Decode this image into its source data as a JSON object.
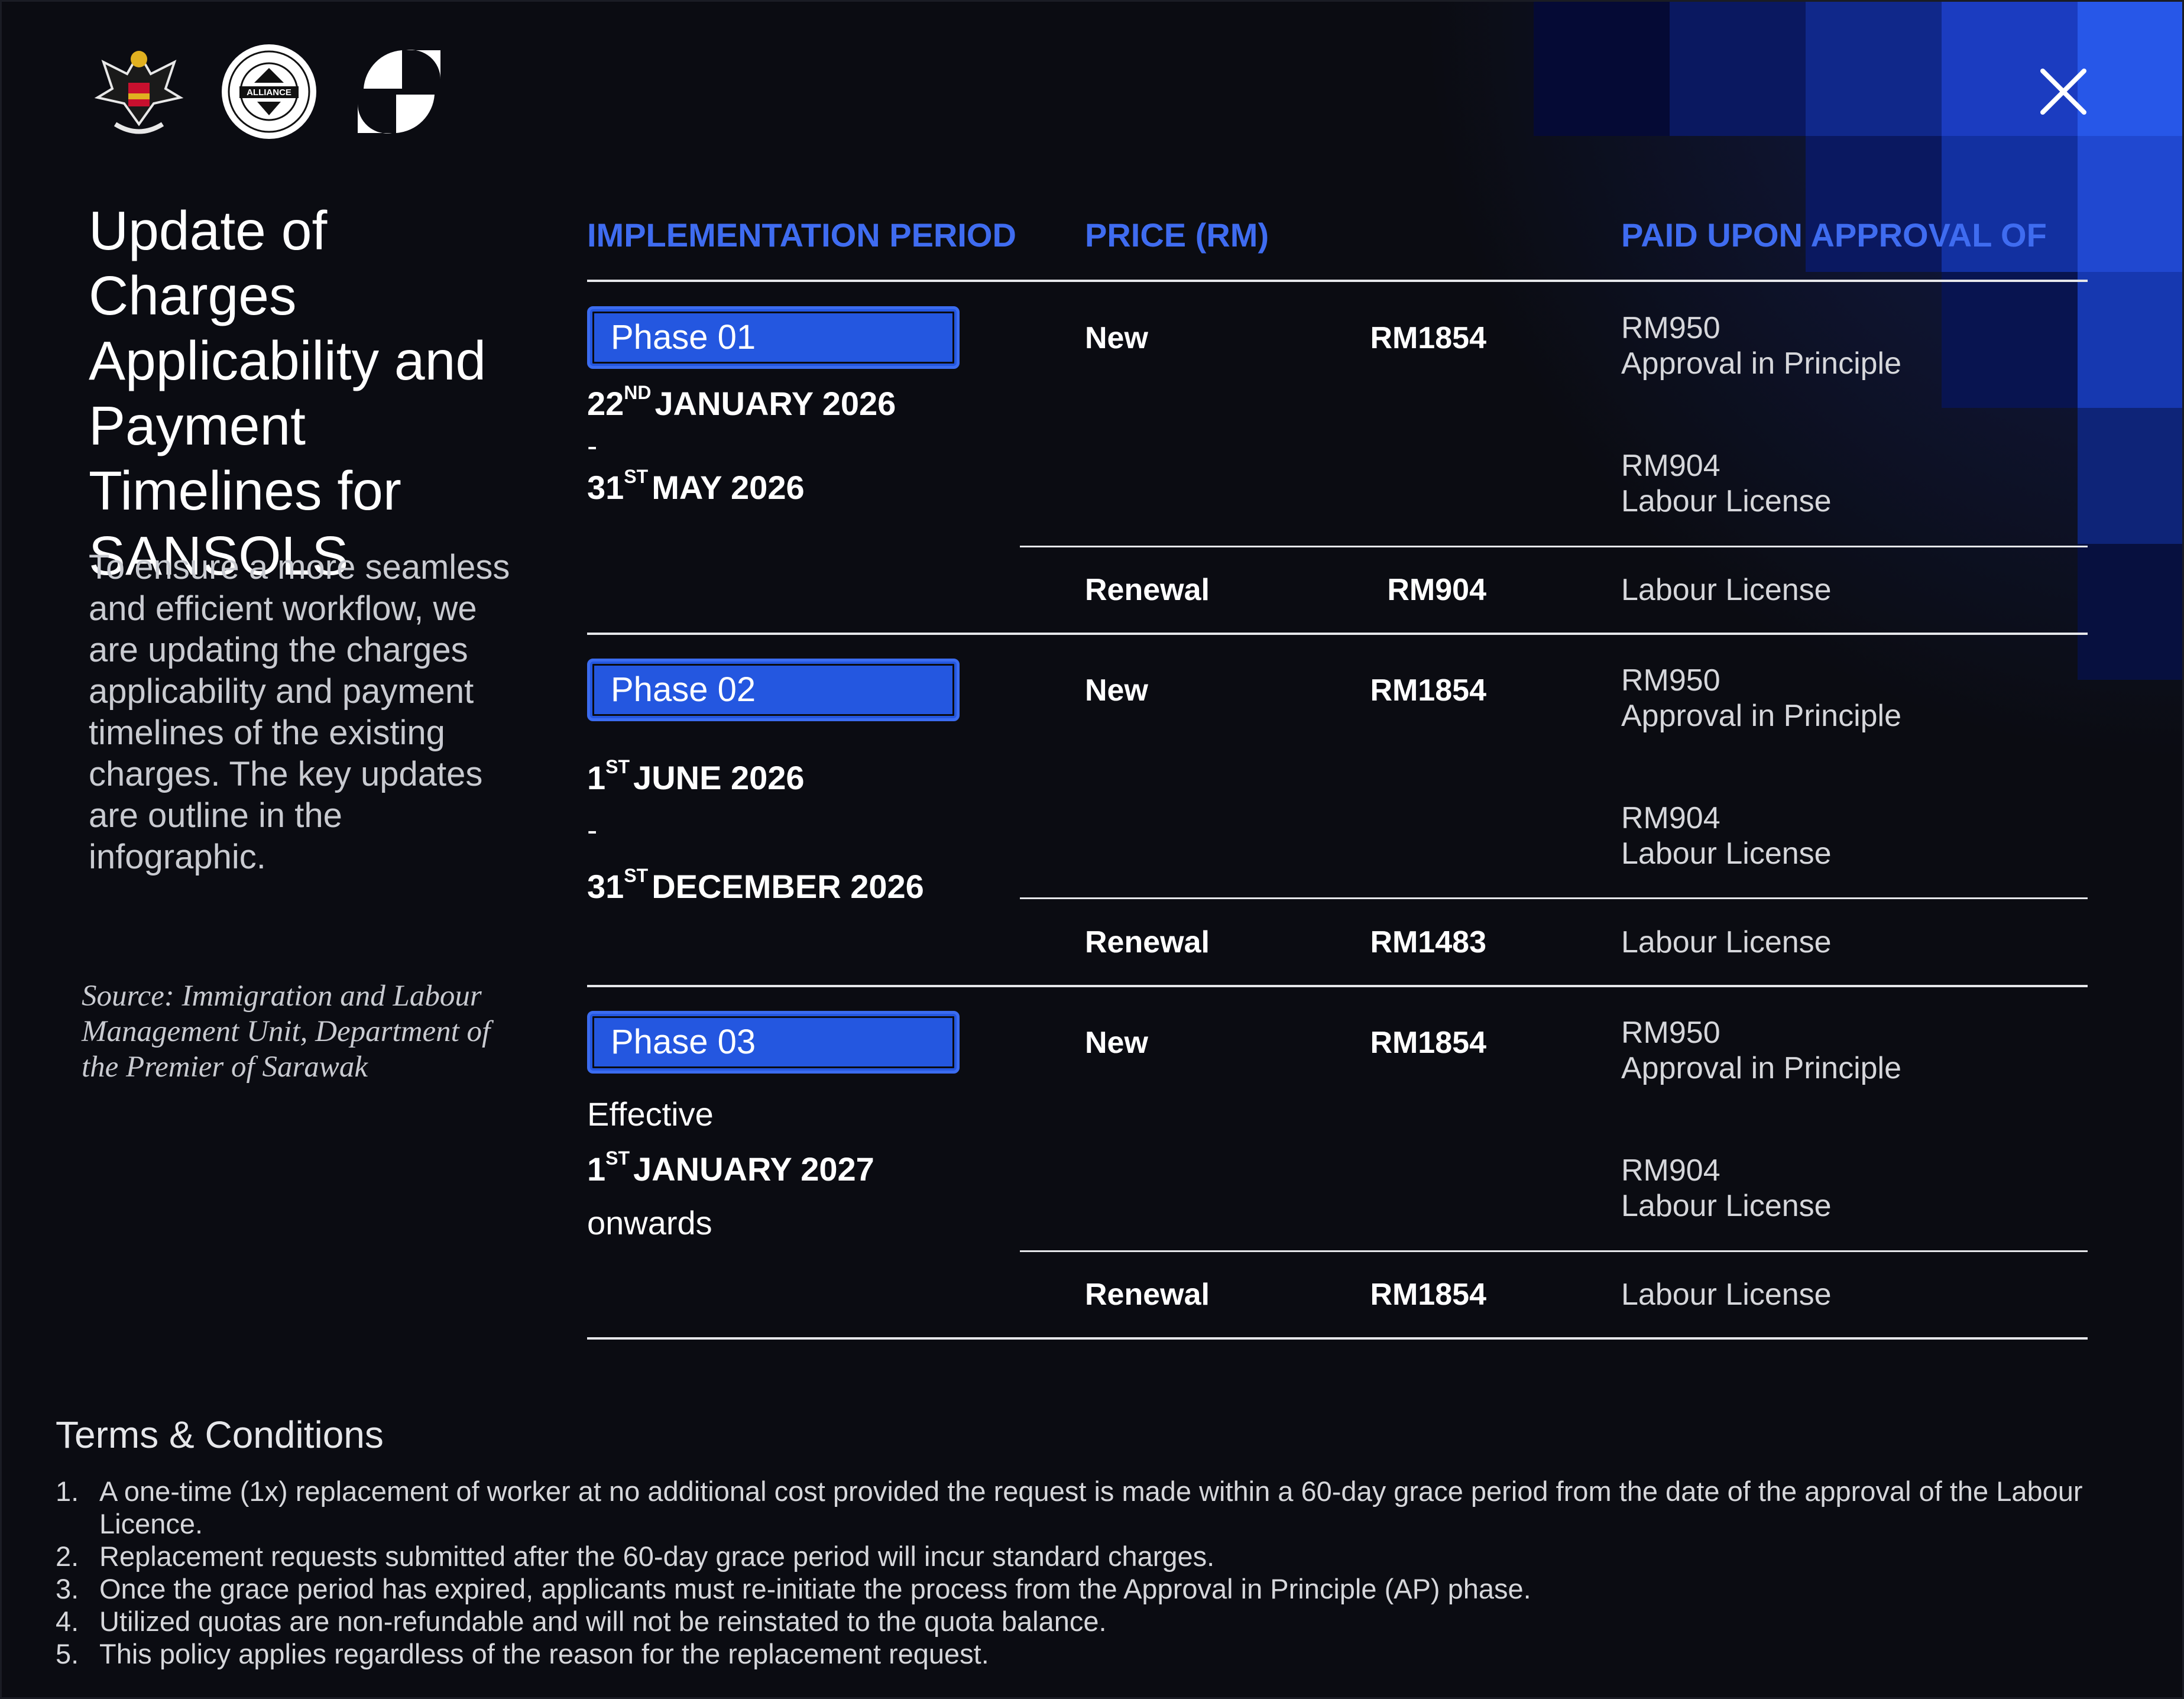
{
  "header": {
    "logos": [
      {
        "name": "sarawak-coat-of-arms-logo"
      },
      {
        "name": "alliance-seal-logo",
        "text": "ALLIANCE"
      },
      {
        "name": "sansols-s-logo"
      }
    ],
    "close_icon": "close-icon"
  },
  "sidebar": {
    "title": "Update of Charges Applicability and Payment Timelines for SANSOLS",
    "intro": "To ensure a more seamless and efficient workflow, we are updating the charges applicability and payment timelines of the existing charges. The key updates are outline in the infographic.",
    "source": "Source: Immigration and Labour Management Unit, Department of the Premier of Sarawak"
  },
  "table": {
    "headers": {
      "period": "IMPLEMENTATION PERIOD",
      "price": "PRICE (RM)",
      "paid": "PAID UPON APPROVAL OF"
    },
    "phases": [
      {
        "badge": "Phase 01",
        "start_day": "22",
        "start_suffix": "ND",
        "start_rest": "JANUARY 2026",
        "separator": "-",
        "end_day": "31",
        "end_suffix": "ST",
        "end_rest": "MAY 2026",
        "new": {
          "label": "New",
          "price": "RM1854",
          "paid": [
            {
              "amount": "RM950",
              "stage": "Approval in Principle"
            },
            {
              "amount": "RM904",
              "stage": "Labour License"
            }
          ]
        },
        "renewal": {
          "label": "Renewal",
          "price": "RM904",
          "paid": "Labour License"
        }
      },
      {
        "badge": "Phase 02",
        "start_day": "1",
        "start_suffix": "ST",
        "start_rest": "JUNE 2026",
        "separator": "-",
        "end_day": "31",
        "end_suffix": "ST",
        "end_rest": "DECEMBER 2026",
        "new": {
          "label": "New",
          "price": "RM1854",
          "paid": [
            {
              "amount": "RM950",
              "stage": "Approval in Principle"
            },
            {
              "amount": "RM904",
              "stage": "Labour License"
            }
          ]
        },
        "renewal": {
          "label": "Renewal",
          "price": "RM1483",
          "paid": "Labour License"
        }
      },
      {
        "badge": "Phase 03",
        "pre": "Effective",
        "start_day": "1",
        "start_suffix": "ST",
        "start_rest": "JANUARY 2027",
        "post": "onwards",
        "new": {
          "label": "New",
          "price": "RM1854",
          "paid": [
            {
              "amount": "RM950",
              "stage": "Approval in Principle"
            },
            {
              "amount": "RM904",
              "stage": "Labour License"
            }
          ]
        },
        "renewal": {
          "label": "Renewal",
          "price": "RM1854",
          "paid": "Labour License"
        }
      }
    ]
  },
  "terms": {
    "title": "Terms & Conditions",
    "items": [
      {
        "num": "1.",
        "text": "A one-time (1x) replacement of worker at no additional cost provided the request is made within a 60-day grace period from the date of the approval of the Labour Licence."
      },
      {
        "num": "2.",
        "text": "Replacement requests submitted after the 60-day grace period will incur standard charges."
      },
      {
        "num": "3.",
        "text": "Once the grace period has expired, applicants must re-initiate the process from the Approval in Principle (AP) phase."
      },
      {
        "num": "4.",
        "text": "Utilized quotas are non-refundable and will not be reinstated to the quota balance."
      },
      {
        "num": "5.",
        "text": "This policy applies regardless of the reason for the replacement request."
      }
    ]
  },
  "colors": {
    "background": "#0b0c12",
    "accent": "#2457e0",
    "header_text": "#3f6cf0"
  }
}
